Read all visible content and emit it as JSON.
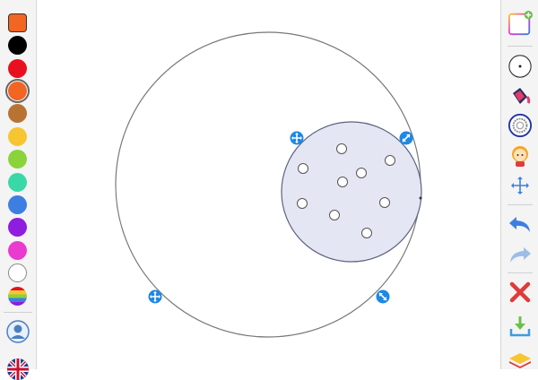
{
  "palette": {
    "swatches": [
      {
        "name": "orange-square",
        "color": "#f26522",
        "shape": "square"
      },
      {
        "name": "black",
        "color": "#000000"
      },
      {
        "name": "red",
        "color": "#e8101f"
      },
      {
        "name": "orange",
        "color": "#f26522",
        "selected": true
      },
      {
        "name": "brown",
        "color": "#b87333"
      },
      {
        "name": "yellow",
        "color": "#f7c531"
      },
      {
        "name": "lime",
        "color": "#8ad33b"
      },
      {
        "name": "teal",
        "color": "#3ad8a6"
      },
      {
        "name": "blue",
        "color": "#3d7fe0"
      },
      {
        "name": "purple",
        "color": "#8e1de0"
      },
      {
        "name": "magenta",
        "color": "#ea3ad0"
      },
      {
        "name": "white",
        "color": "#ffffff"
      },
      {
        "name": "rainbow",
        "color": "rainbow"
      }
    ],
    "bottom_icons": [
      "user-icon",
      "language-flag-icon"
    ]
  },
  "toolbar": {
    "tools": [
      "new-canvas-icon",
      "point-tool-icon",
      "paint-bucket-icon",
      "spirograph-icon",
      "character-icon",
      "move-icon",
      "undo-icon",
      "redo-icon",
      "delete-icon",
      "download-icon",
      "layers-icon"
    ]
  },
  "canvas": {
    "big_circle_color": "#777777",
    "small_circle_fill": "#e4e6f4",
    "small_circle_stroke": "#5a6280",
    "handle_color": "#1e88e5",
    "dots_count": 10
  }
}
